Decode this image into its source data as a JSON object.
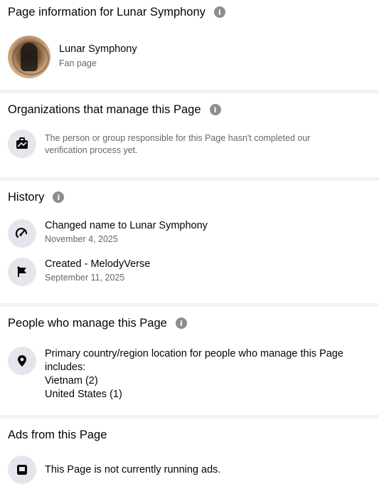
{
  "page_info": {
    "title": "Page information for Lunar Symphony",
    "name": "Lunar Symphony",
    "category": "Fan page"
  },
  "organizations": {
    "title": "Organizations that manage this Page",
    "message": "The person or group responsible for this Page hasn't completed our verification process yet."
  },
  "history": {
    "title": "History",
    "items": [
      {
        "label": "Changed name to Lunar Symphony",
        "date": "November 4, 2025",
        "icon": "name-change-icon"
      },
      {
        "label": "Created - MelodyVerse",
        "date": "September 11, 2025",
        "icon": "flag-icon"
      }
    ]
  },
  "people": {
    "title": "People who manage this Page",
    "location_label": "Primary country/region location for people who manage this Page includes:",
    "countries": [
      "Vietnam (2)",
      "United States (1)"
    ]
  },
  "ads": {
    "title": "Ads from this Page",
    "message": "This Page is not currently running ads."
  },
  "info_icon_glyph": "i"
}
